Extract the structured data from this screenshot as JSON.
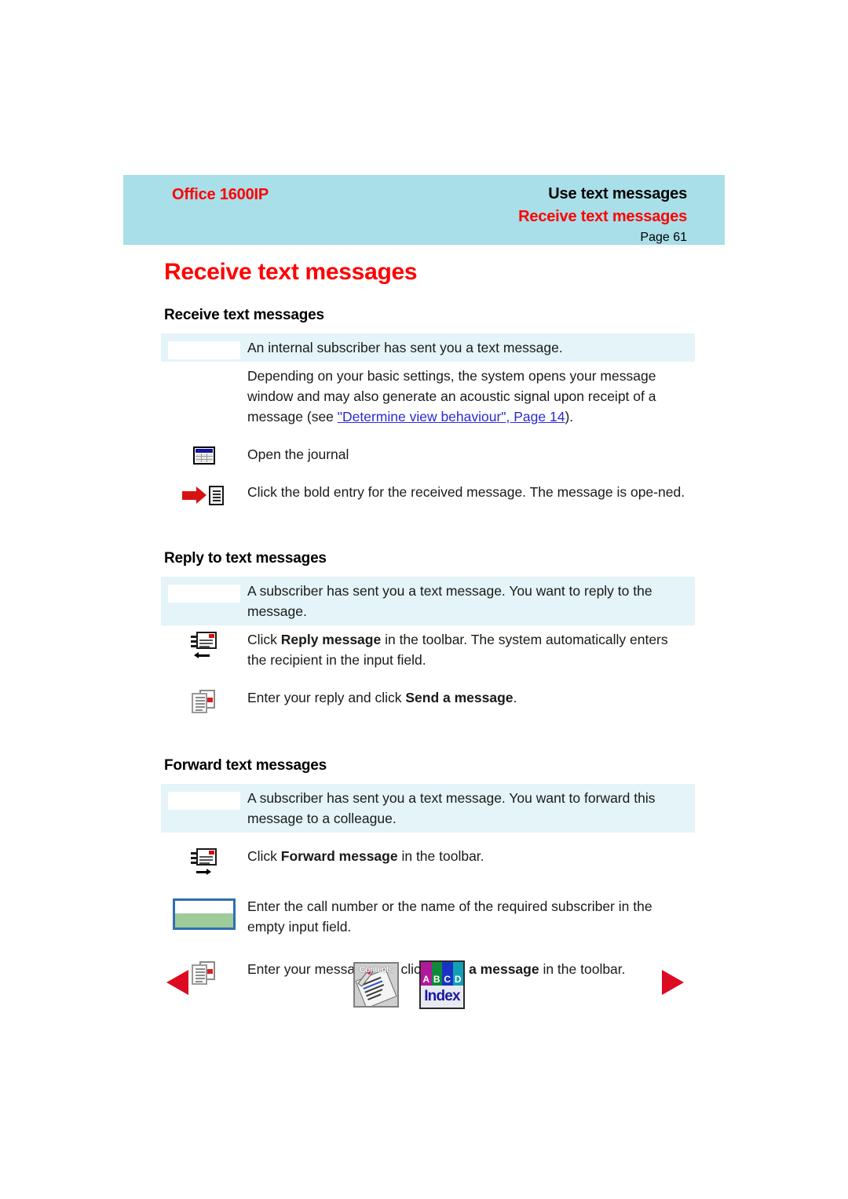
{
  "header": {
    "product": "Office 1600IP",
    "chapter": "Use text messages",
    "section": "Receive text messages",
    "page": "Page 61"
  },
  "page_title": "Receive text messages",
  "sections": [
    {
      "heading": "Receive text messages",
      "rows": [
        {
          "icon": "precondition-box",
          "tinted": true,
          "text": "An internal subscriber has sent you a text message."
        },
        {
          "icon": "none",
          "tinted": false,
          "text_parts": {
            "pre": "Depending on your basic settings, the system opens your message window and may also generate an acoustic signal upon receipt of a message (see ",
            "link": "\"Determine view behaviour\", Page 14",
            "post": ")."
          }
        },
        {
          "icon": "journal-table-icon",
          "tinted": false,
          "text": "Open the journal"
        },
        {
          "icon": "red-arrow-document-icon",
          "tinted": false,
          "text": "Click the bold entry for the received message. The message is ope-ned."
        }
      ]
    },
    {
      "heading": "Reply to text messages",
      "rows": [
        {
          "icon": "precondition-box",
          "tinted": true,
          "text": "A subscriber has sent you a text message. You want to reply to the message."
        },
        {
          "icon": "reply-message-icon",
          "tinted": false,
          "text_parts": {
            "pre": "Click ",
            "bold": "Reply message",
            "post": " in the toolbar. The system automatically enters the recipient in the input field."
          }
        },
        {
          "icon": "send-message-icon",
          "tinted": false,
          "text_parts": {
            "pre": "Enter your reply and click ",
            "bold": "Send a message",
            "post": "."
          }
        }
      ]
    },
    {
      "heading": "Forward text messages",
      "rows": [
        {
          "icon": "precondition-box",
          "tinted": true,
          "text": "A subscriber has sent you a text message. You want to forward this message to a colleague."
        },
        {
          "icon": "forward-message-icon",
          "tinted": false,
          "text_parts": {
            "pre": "Click ",
            "bold": "Forward message",
            "post": " in the toolbar."
          }
        },
        {
          "icon": "input-field-icon",
          "tinted": false,
          "text": "Enter the call number or the name of the required subscriber in the empty input field."
        },
        {
          "icon": "send-message-icon",
          "tinted": false,
          "text_parts": {
            "pre": "Enter your message and click ",
            "bold": "Send a message",
            "post": " in the toolbar."
          }
        }
      ]
    }
  ],
  "bottom_nav": {
    "prev_label": "previous-page-arrow",
    "next_label": "next-page-arrow",
    "contents_label": "Contents",
    "index_label": "Index",
    "index_tabs": [
      "A",
      "B",
      "C",
      "D"
    ]
  },
  "colors": {
    "banner": "#a9dfe8",
    "tint": "#e4f4f8",
    "accent_red": "#ff0000",
    "link_blue": "#2b2bd4",
    "nav_red": "#dd0b22"
  }
}
